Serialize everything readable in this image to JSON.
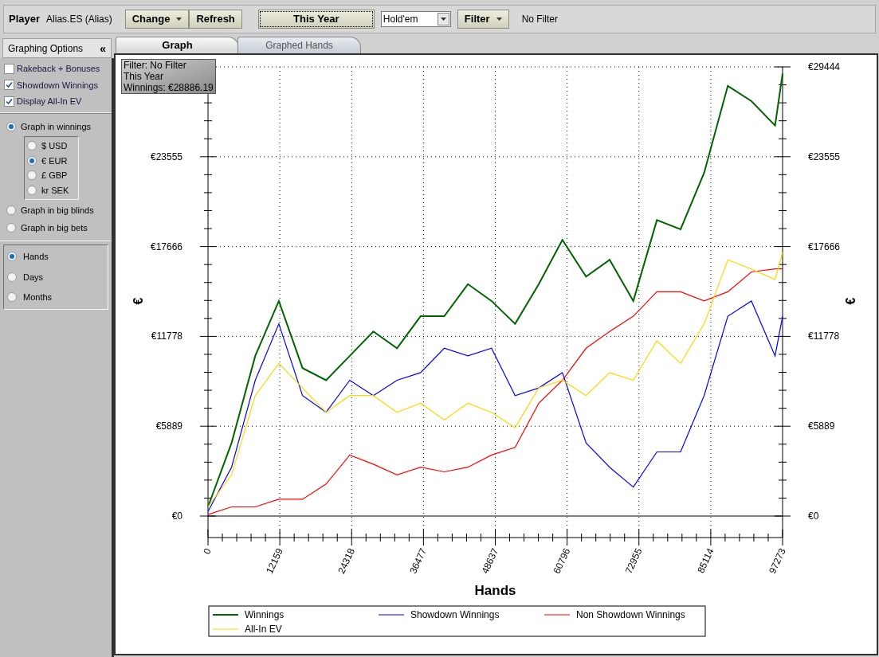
{
  "toolbar": {
    "label": "Player",
    "player": "Alias.ES (Alias)",
    "buttons": [
      {
        "label": "Change",
        "kind": "dropdown"
      },
      {
        "label": "Refresh",
        "kind": "plain"
      }
    ],
    "period_button": "This Year",
    "game_select": "Hold'em",
    "filter_button": "Filter",
    "filter_status": "No Filter"
  },
  "sidebar": {
    "title": "Graphing Options",
    "collapse": "«",
    "options": [
      {
        "label": "Rakeback + Bonuses",
        "checked": false
      },
      {
        "label": "Showdown Winnings",
        "checked": true
      },
      {
        "label": "Display All-In EV",
        "checked": true
      }
    ],
    "units": [
      {
        "label": "Graph in winnings",
        "selected": true,
        "currencies": [
          {
            "label": "$ USD",
            "selected": false
          },
          {
            "label": "€ EUR",
            "selected": true
          },
          {
            "label": "£ GBP",
            "selected": false
          },
          {
            "label": "kr SEK",
            "selected": false
          }
        ]
      },
      {
        "label": "Graph in big blinds",
        "selected": false
      },
      {
        "label": "Graph in big bets",
        "selected": false
      }
    ],
    "x_axis": [
      {
        "label": "Hands",
        "selected": true
      },
      {
        "label": "Days",
        "selected": false
      },
      {
        "label": "Months",
        "selected": false
      }
    ]
  },
  "tabs": [
    {
      "label": "Graph",
      "selected": true
    },
    {
      "label": "Graphed Hands",
      "selected": false
    }
  ],
  "graph": {
    "info": [
      "Filter: No Filter",
      "This Year",
      "Winnings: €28886.19"
    ],
    "ylabel_right": "€",
    "chart_data": {
      "type": "line",
      "xlabel": "Hands",
      "ylabel": "€",
      "xlim": [
        0,
        97273
      ],
      "ylim": [
        0,
        29444
      ],
      "grid": true,
      "legend": true,
      "x": [
        0,
        4000,
        8000,
        12000,
        16000,
        20000,
        24000,
        28000,
        32000,
        36000,
        40000,
        44000,
        48000,
        52000,
        56000,
        60000,
        64000,
        68000,
        72000,
        76000,
        80000,
        84000,
        88000,
        92000,
        96000,
        97273
      ],
      "series": [
        {
          "name": "Winnings",
          "color": "#006400",
          "values": [
            600,
            4800,
            10500,
            14100,
            9700,
            8900,
            10500,
            12100,
            11000,
            13100,
            13100,
            15200,
            14100,
            12600,
            15200,
            18100,
            15700,
            16800,
            14100,
            19400,
            18800,
            22500,
            28200,
            27200,
            25600,
            29000
          ]
        },
        {
          "name": "Showdown Winnings",
          "color": "#0000ff",
          "values": [
            300,
            3200,
            8900,
            12600,
            7900,
            6800,
            8900,
            7900,
            8900,
            9400,
            11000,
            10500,
            11000,
            7900,
            8400,
            9400,
            4800,
            3200,
            1900,
            4200,
            4200,
            7900,
            13100,
            14100,
            10500,
            13100
          ]
        },
        {
          "name": "Non Showdown Winnings",
          "color": "#ff0000",
          "values": [
            100,
            600,
            600,
            1100,
            1100,
            2100,
            4000,
            3400,
            2700,
            3200,
            2900,
            3200,
            4000,
            4500,
            7400,
            8900,
            11000,
            12100,
            13100,
            14700,
            14700,
            14100,
            14700,
            16000,
            16200,
            16200
          ]
        },
        {
          "name": "All-In EV",
          "color": "#ffd700",
          "values": [
            600,
            2700,
            7900,
            10000,
            8400,
            6800,
            7900,
            7900,
            6800,
            7400,
            6300,
            7400,
            6800,
            5800,
            8400,
            8900,
            7900,
            9400,
            8900,
            11500,
            10000,
            12600,
            16800,
            16200,
            15500,
            17300
          ]
        }
      ],
      "xticks": [
        0,
        12159,
        24318,
        36477,
        48637,
        60796,
        72955,
        85114,
        97273
      ],
      "yticks": [
        {
          "value": 0,
          "label": "€0"
        },
        {
          "value": 5889,
          "label": "€5889"
        },
        {
          "value": 11778,
          "label": "€11778"
        },
        {
          "value": 17666,
          "label": "€17666"
        },
        {
          "value": 23555,
          "label": "€23555"
        },
        {
          "value": 29444,
          "label": "€29444"
        }
      ]
    }
  }
}
